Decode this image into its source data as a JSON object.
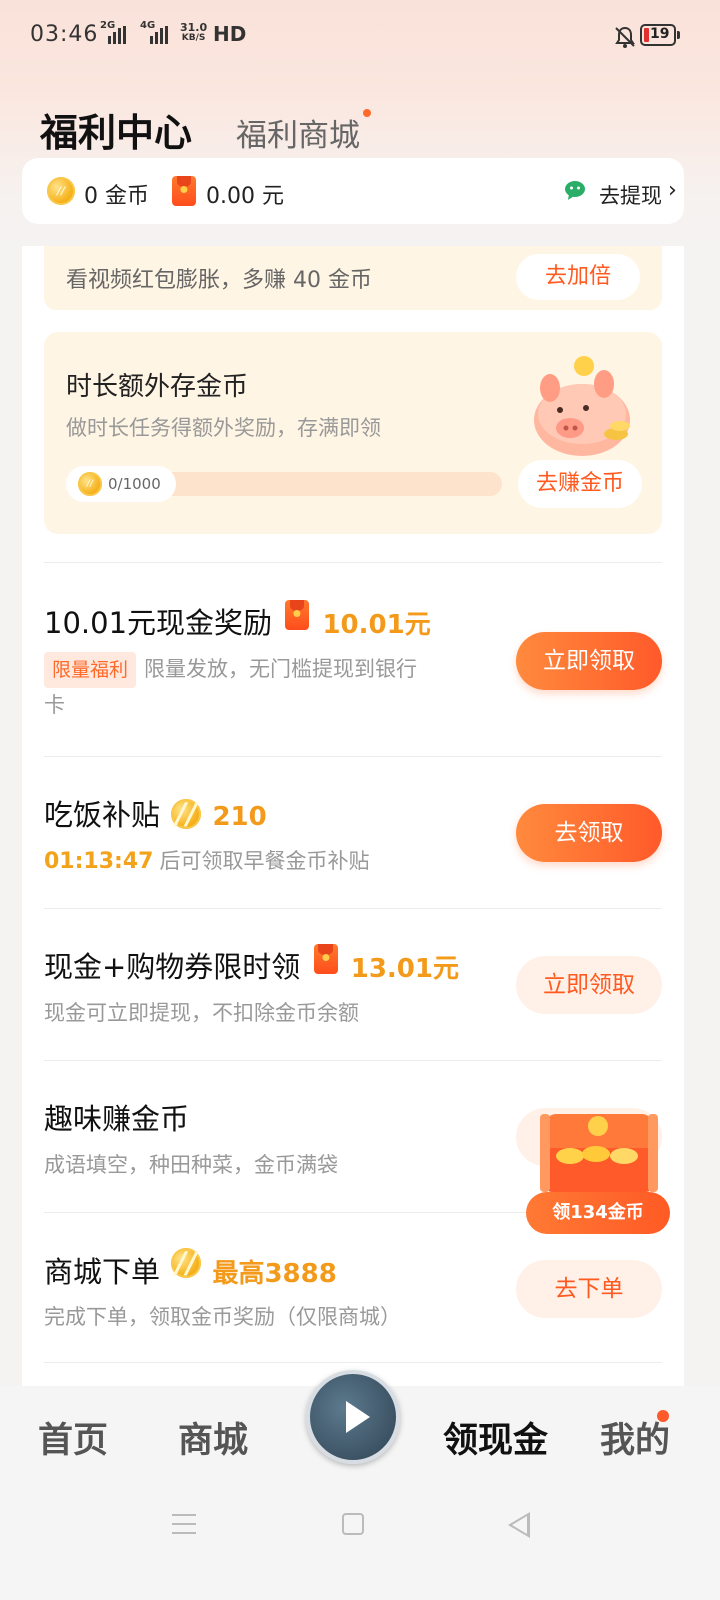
{
  "status_bar": {
    "time": "03:46",
    "sim1": "2G",
    "sim2": "4G",
    "net_speed_value": "31.0",
    "net_speed_unit": "KB/S",
    "hd": "HD",
    "battery": "19"
  },
  "header": {
    "active_tab": "福利中心",
    "tab": "福利商城"
  },
  "balance": {
    "coins": "0 金币",
    "cash": "0.00 元",
    "withdraw": "去提现"
  },
  "double_banner": {
    "text": "看视频红包膨胀，多赚 40 金币",
    "button": "去加倍"
  },
  "extra_card": {
    "title": "时长额外存金币",
    "subtitle": "做时长任务得额外奖励，存满即领",
    "progress_text": "0/1000",
    "progress_fraction": 0,
    "button": "去赚金币"
  },
  "tasks": [
    {
      "name": "10.01元现金奖励",
      "amount": "10.01元",
      "tag": "限量福利",
      "desc_line1": "限量发放，无门槛提现到银行",
      "desc_line2": "卡",
      "button": "立即领取"
    },
    {
      "name": "吃饭补贴",
      "amount": "210",
      "countdown": "01:13:47",
      "desc": "后可领取早餐金币补贴",
      "button": "去领取"
    },
    {
      "name": "现金+购物券限时领",
      "amount": "13.01元",
      "desc": "现金可立即提现，不扣除金币余额",
      "button": "立即领取"
    },
    {
      "name": "趣味赚金币",
      "desc": "成语填空，种田种菜，金币满袋",
      "chest_label": "领134金币"
    },
    {
      "name": "商城下单",
      "amount": "最高3888",
      "desc": "完成下单，领取金币奖励（仅限商城）",
      "button": "去下单"
    }
  ],
  "bottom_nav": {
    "home": "首页",
    "mall": "商城",
    "cash": "领现金",
    "mine": "我的"
  },
  "colors": {
    "accent": "#ff5a1f",
    "coin_amount": "#f39a1b",
    "card_bg": "#fff5e4"
  },
  "icons": [
    "coin-icon",
    "red-packet-icon",
    "wechat-icon",
    "chevron-right-icon",
    "piggy-bank-icon",
    "treasure-chest-icon",
    "play-icon",
    "mute-icon",
    "battery-icon"
  ]
}
